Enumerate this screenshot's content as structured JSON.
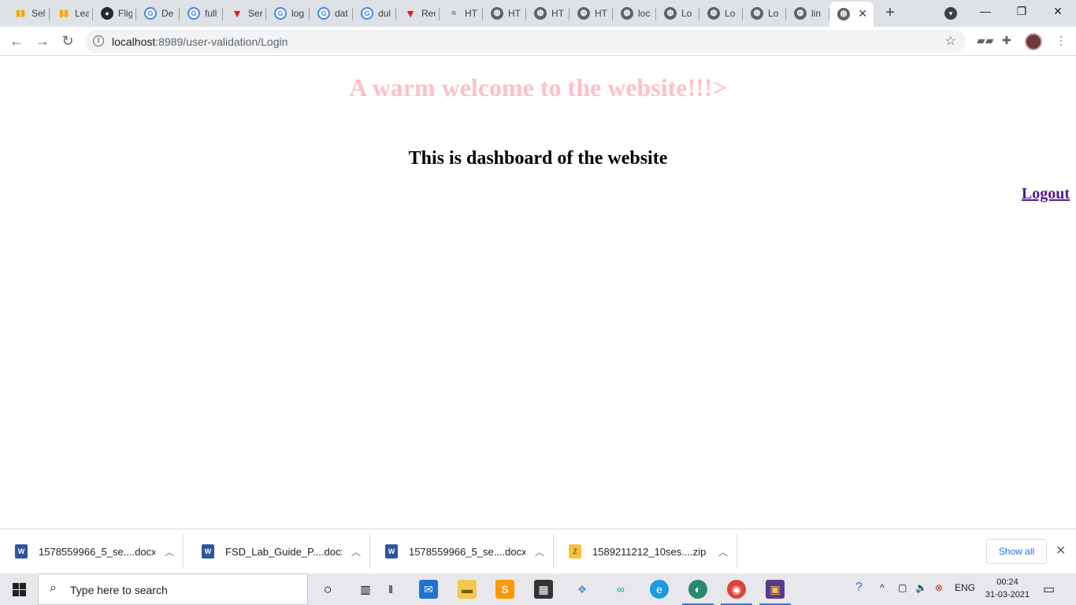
{
  "browser": {
    "tabs": [
      {
        "label": "Sel",
        "icon": "chart-icon"
      },
      {
        "label": "Lea",
        "icon": "chart-icon"
      },
      {
        "label": "Flig",
        "icon": "github-icon"
      },
      {
        "label": "De",
        "icon": "google-icon"
      },
      {
        "label": "full",
        "icon": "google-icon"
      },
      {
        "label": "Ser",
        "icon": "triangle-v-icon"
      },
      {
        "label": "log",
        "icon": "google-icon"
      },
      {
        "label": "dat",
        "icon": "google-icon"
      },
      {
        "label": "dul",
        "icon": "google-icon"
      },
      {
        "label": "Rec",
        "icon": "triangle-v-icon"
      },
      {
        "label": "HT",
        "icon": "gfg-icon"
      },
      {
        "label": "HT",
        "icon": "globe-icon"
      },
      {
        "label": "HT",
        "icon": "globe-icon"
      },
      {
        "label": "HT",
        "icon": "globe-icon"
      },
      {
        "label": "loc",
        "icon": "globe-icon"
      },
      {
        "label": "Lo",
        "icon": "globe-icon"
      },
      {
        "label": "Lo",
        "icon": "globe-icon"
      },
      {
        "label": "Lo",
        "icon": "globe-icon"
      },
      {
        "label": "lin",
        "icon": "globe-icon"
      }
    ],
    "active_tab": {
      "label": "",
      "icon": "globe-icon"
    },
    "url_host": "localhost",
    "url_rest": ":8989/user-validation/Login"
  },
  "page": {
    "welcome": "A warm welcome to the website!!!>",
    "dashboard": "This is dashboard of the website",
    "logout": "Logout"
  },
  "downloads": {
    "items": [
      {
        "name": "1578559966_5_se....docx",
        "type": "word"
      },
      {
        "name": "FSD_Lab_Guide_P....docx",
        "type": "word"
      },
      {
        "name": "1578559966_5_se....docx",
        "type": "word"
      },
      {
        "name": "1589211212_10ses....zip",
        "type": "zip"
      }
    ],
    "show_all": "Show all"
  },
  "taskbar": {
    "search_placeholder": "Type here to search",
    "language": "ENG",
    "time": "00:24",
    "date": "31-03-2021"
  }
}
